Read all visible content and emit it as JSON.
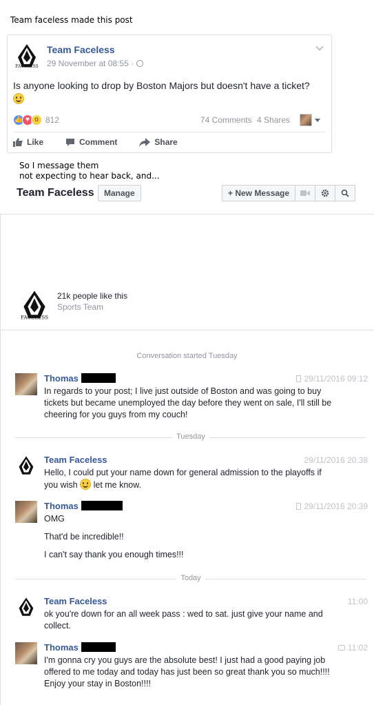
{
  "captions": {
    "top": "Team faceless made this post",
    "middle_line1": "So I message them",
    "middle_line2": "not expecting to hear back, and..."
  },
  "post": {
    "author": "Team Faceless",
    "timestamp": "29 November at 08:55 ·",
    "text": "Is anyone looking to drop by Boston Majors but doesn't have a ticket?",
    "reaction_count": "812",
    "comments": "74 Comments",
    "shares": "4 Shares",
    "actions": {
      "like": "Like",
      "comment": "Comment",
      "share": "Share"
    },
    "logo_text": "FACELESS"
  },
  "messenger": {
    "page_name": "Team Faceless",
    "manage_label": "Manage",
    "new_message_label": "+ New Message",
    "likes_text": "21k people like this",
    "category": "Sports Team",
    "conversation_started": "Conversation started Tuesday"
  },
  "separators": {
    "tuesday": "Tuesday",
    "today": "Today"
  },
  "messages": [
    {
      "sender": "Thomas",
      "time": "29/11/2016 09:12",
      "lines": [
        "In regards to your post; I live just outside of Boston and was going to buy tickets but became unemployed the day before they went on sale, I'll still be cheering for you guys from my couch!"
      ]
    },
    {
      "sender": "Team Faceless",
      "time": "29/11/2016 20:38",
      "text_before": "Hello, I could put your name down for general admission to the playoffs if you wish",
      "text_after": " let me know."
    },
    {
      "sender": "Thomas",
      "time": "29/11/2016 20:39",
      "lines": [
        "OMG",
        "That'd be incredible!!",
        "I can't say thank you enough times!!!"
      ]
    },
    {
      "sender": "Team Faceless",
      "time": "11:00",
      "lines": [
        "ok you're down for an all week pass : wed to sat. just give your name and collect."
      ]
    },
    {
      "sender": "Thomas",
      "time": "11:02",
      "lines": [
        "I'm gonna cry you guys are the absolute best! I just had a good paying job offered to me today and today has just been so great thank you so much!!!! Enjoy your stay in Boston!!!!"
      ]
    }
  ]
}
